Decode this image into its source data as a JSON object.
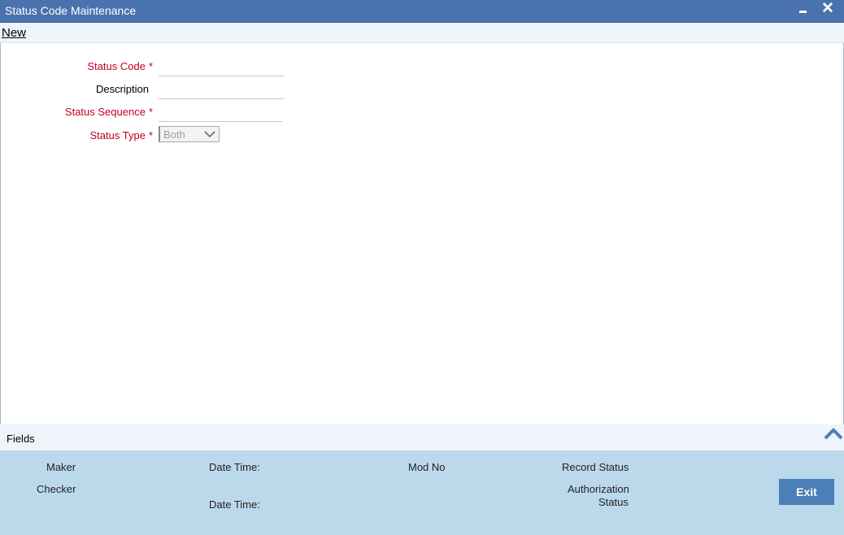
{
  "window": {
    "title": "Status Code Maintenance",
    "minimize_icon": "minimize-icon",
    "close_icon": "close-icon",
    "close_glyph": "✕"
  },
  "menu": {
    "new_label": "New"
  },
  "form": {
    "status_code": {
      "label": "Status Code",
      "required": "*",
      "value": ""
    },
    "description": {
      "label": "Description",
      "value": ""
    },
    "status_sequence": {
      "label": "Status Sequence",
      "required": "*",
      "value": ""
    },
    "status_type": {
      "label": "Status Type",
      "required": "*",
      "selected": "Both"
    }
  },
  "fields_bar": {
    "label": "Fields",
    "toggle_icon": "chevron-up-icon"
  },
  "audit": {
    "maker": "Maker",
    "date_time_1": "Date Time:",
    "mod_no": "Mod No",
    "record_status": "Record Status",
    "checker": "Checker",
    "date_time_2": "Date Time:",
    "authorization_status_1": "Authorization",
    "authorization_status_2": "Status"
  },
  "actions": {
    "exit_label": "Exit"
  },
  "colors": {
    "title_bar": "#4a73ad",
    "footer": "#bcd9ec",
    "required": "#c00020",
    "exit_button": "#4a80b5"
  }
}
